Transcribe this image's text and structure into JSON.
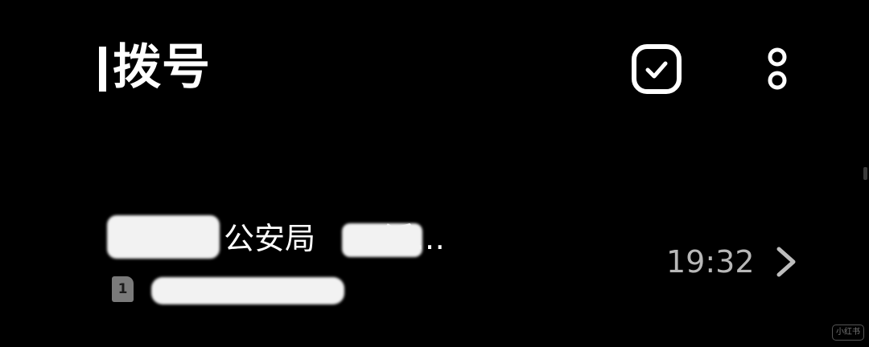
{
  "header": {
    "title": "拨号"
  },
  "toolbar": {
    "select_icon": "check-square-icon",
    "more_icon": "more-vertical-icon"
  },
  "call_log": [
    {
      "name": "公安局",
      "name_suffix": "派…",
      "time": "19:32",
      "sim": "1"
    }
  ],
  "watermark": "小红书",
  "colors": {
    "background": "#000000",
    "text": "#ffffff",
    "secondary": "#b8b8b8"
  }
}
